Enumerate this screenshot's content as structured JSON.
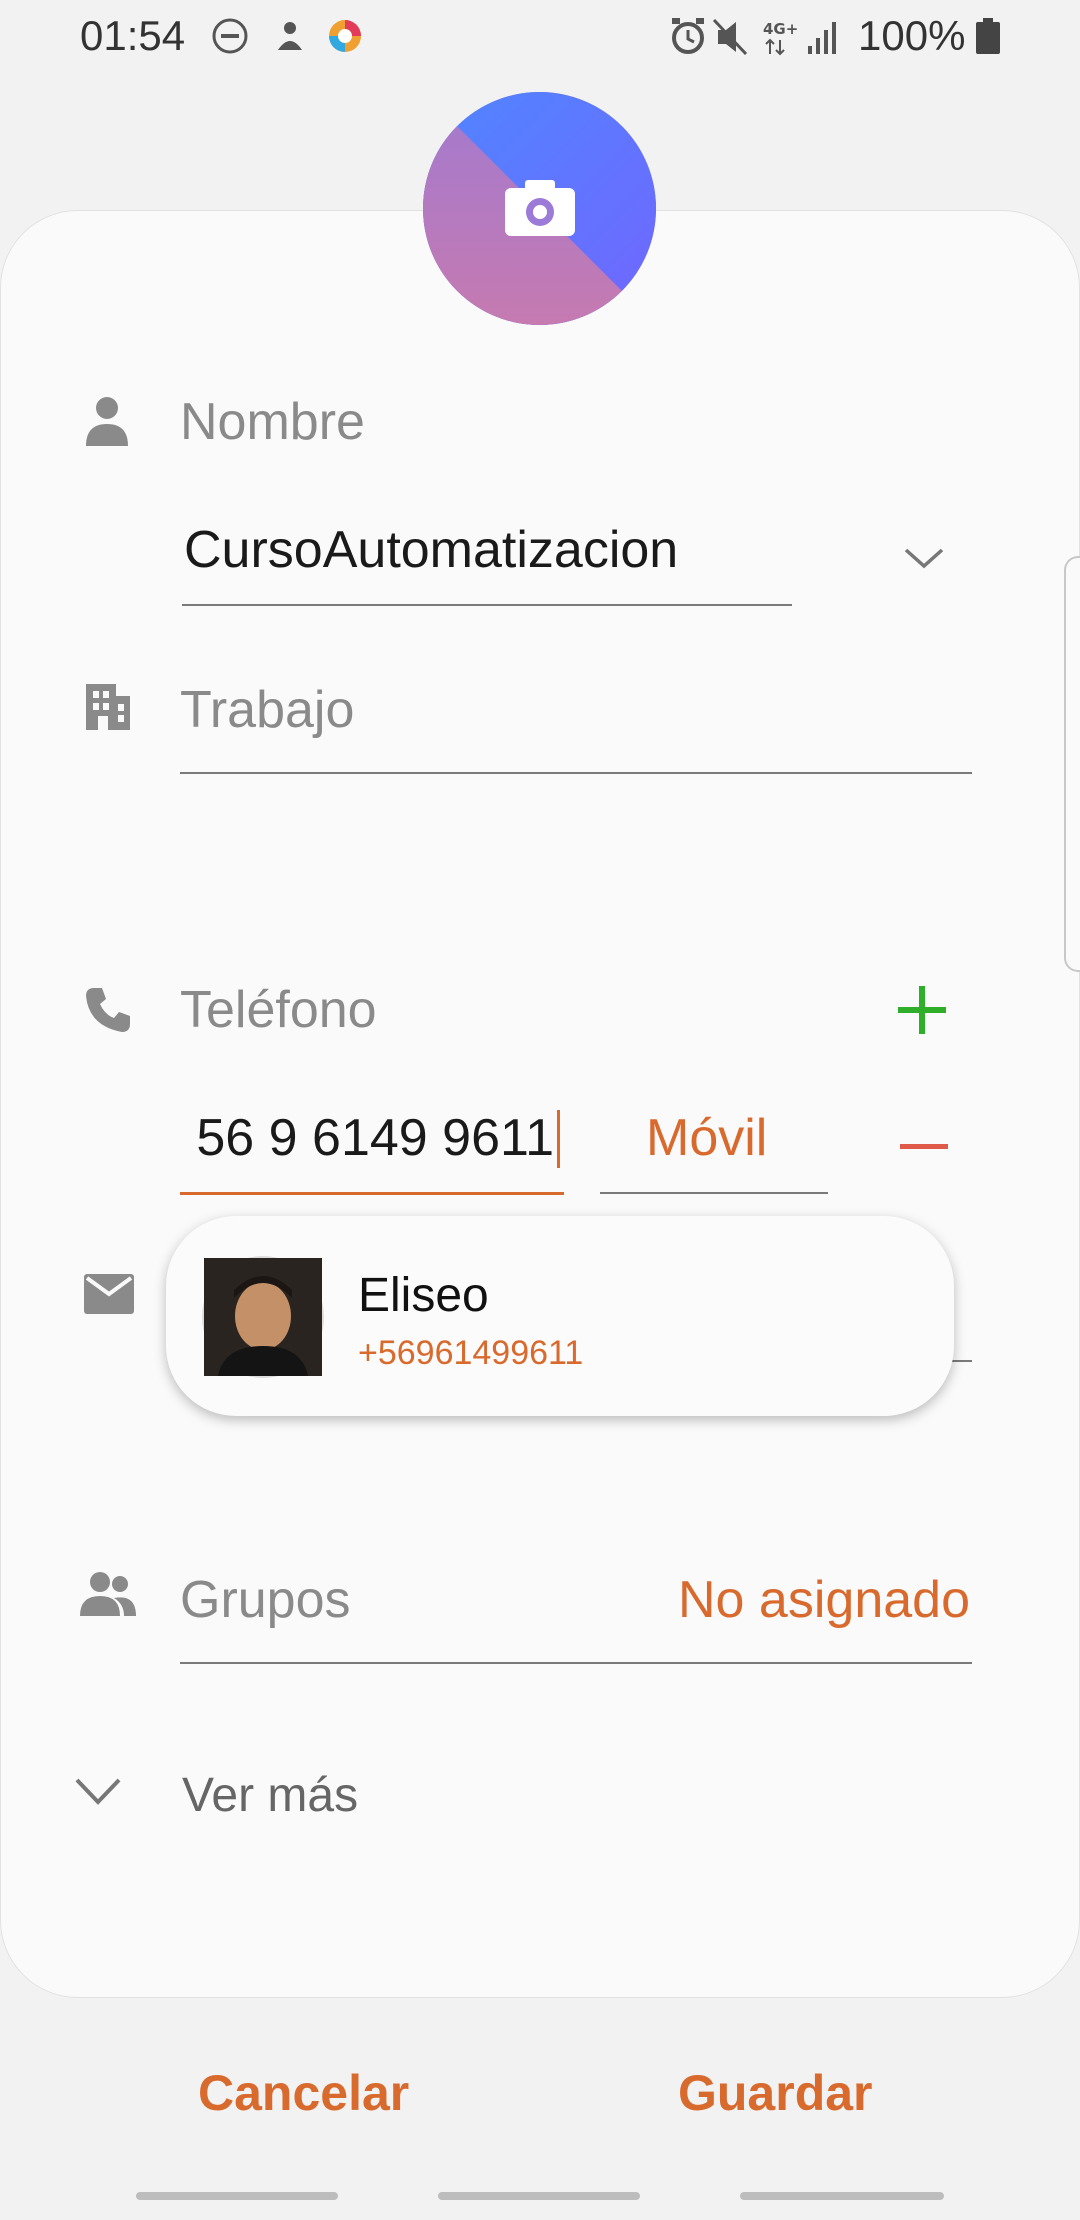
{
  "status_bar": {
    "time": "01:54",
    "battery": "100%",
    "network": "4G+"
  },
  "contact_form": {
    "name": {
      "label": "Nombre",
      "value": "CursoAutomatizacion"
    },
    "work": {
      "label": "Trabajo"
    },
    "phone": {
      "label": "Teléfono",
      "value": "56 9 6149 9611",
      "type": "Móvil"
    },
    "groups": {
      "label": "Grupos",
      "value": "No asignado"
    },
    "see_more": "Ver más"
  },
  "suggestion": {
    "name": "Eliseo",
    "number": "+56961499611"
  },
  "actions": {
    "cancel": "Cancelar",
    "save": "Guardar"
  },
  "colors": {
    "accent": "#d96a2e",
    "add": "#2fae2a",
    "remove": "#e05a4a"
  }
}
